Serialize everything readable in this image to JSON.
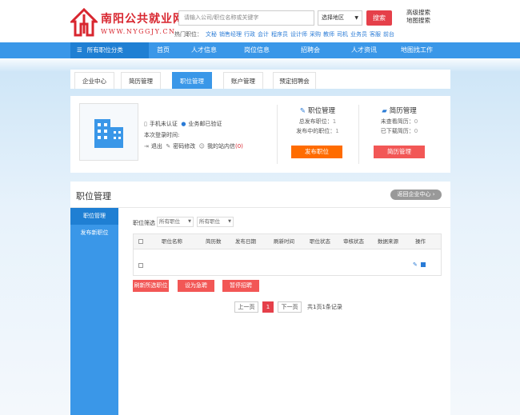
{
  "header": {
    "logo_name": "南阳公共就业网",
    "logo_url": "WWW.NYGGJY.CN",
    "search_placeholder": "请输入公司/职位名称或关键字",
    "region_select": "选择地区",
    "search_button": "搜索",
    "advanced_search": "高级搜索",
    "map_search": "地图搜索",
    "hot_label": "热门职位：",
    "hot_jobs": [
      "文秘",
      "销售经理",
      "行政",
      "会计",
      "程序员",
      "设计师",
      "采购",
      "教师",
      "司机",
      "业务员",
      "客服",
      "前台"
    ]
  },
  "nav": {
    "category": "所有职位分类",
    "items": [
      "首页",
      "人才信息",
      "岗位信息",
      "招聘会",
      "人才资讯",
      "地图找工作"
    ]
  },
  "tabs": [
    "企业中心",
    "简历管理",
    "职位管理",
    "账户管理",
    "预定招聘会"
  ],
  "tabs_active": "职位管理",
  "company": {
    "phone_status": "手机未认证",
    "email_status": "业务邮已验证",
    "login_time": "本次登录时间:",
    "logout": "退出",
    "change_password": "密码修改",
    "messages_label": "我的站内信",
    "messages_count": "(0)"
  },
  "job_stats": {
    "title": "职位管理",
    "total_label": "总发布职位：",
    "total_value": "1",
    "active_label": "发布中的职位：",
    "active_value": "1",
    "button": "发布职位"
  },
  "resume_stats": {
    "title": "简历管理",
    "unviewed_label": "未查看简历：",
    "unviewed_value": "0",
    "downloaded_label": "已下载简历：",
    "downloaded_value": "0",
    "button": "简历管理"
  },
  "panel": {
    "title": "职位管理",
    "back_button": "返回企业中心",
    "side_menu": [
      "职位管理",
      "发布新职位"
    ],
    "filter_label": "职位筛选",
    "filter_selects": [
      "所有职位",
      "所有职位"
    ],
    "columns": [
      "职位名称",
      "简历数",
      "发布日期",
      "刷新时间",
      "职位状态",
      "审核状态",
      "数据来源",
      "操作"
    ],
    "actions": [
      "刷新所选职位",
      "设为急聘",
      "暂停招聘"
    ]
  },
  "pagination": {
    "prev": "上一页",
    "current": "1",
    "next": "下一页",
    "info": "共1页1条记录"
  },
  "colors": {
    "brand_red": "#d8262f",
    "nav_blue": "#3a97e8",
    "dark_blue": "#1f7fd3",
    "orange": "#ff6c00",
    "button_red": "#f25756"
  }
}
